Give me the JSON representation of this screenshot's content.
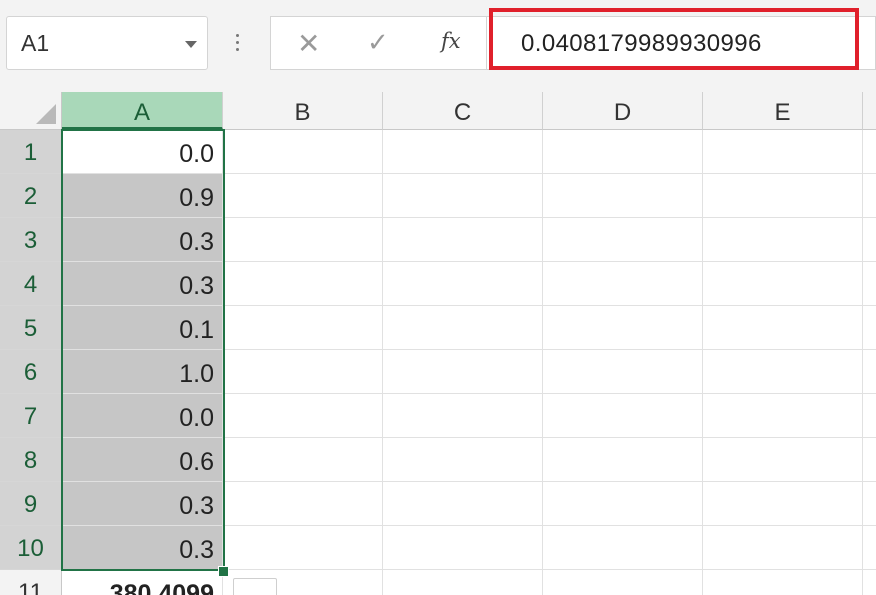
{
  "formula_bar": {
    "name_box": "A1",
    "cancel_icon": "✕",
    "enter_icon": "✓",
    "fx_label": "fx",
    "value": "0.0408179989930996"
  },
  "columns": [
    "A",
    "B",
    "C",
    "D",
    "E"
  ],
  "rows": [
    {
      "num": "1",
      "a": "0.0"
    },
    {
      "num": "2",
      "a": "0.9"
    },
    {
      "num": "3",
      "a": "0.3"
    },
    {
      "num": "4",
      "a": "0.3"
    },
    {
      "num": "5",
      "a": "0.1"
    },
    {
      "num": "6",
      "a": "1.0"
    },
    {
      "num": "7",
      "a": "0.0"
    },
    {
      "num": "8",
      "a": "0.6"
    },
    {
      "num": "9",
      "a": "0.3"
    },
    {
      "num": "10",
      "a": "0.3"
    },
    {
      "num": "11",
      "a": "380.4099"
    }
  ],
  "colors": {
    "selection_border": "#217346",
    "highlight_border": "#e0202b",
    "active_column_header": "#a9d8b9",
    "selected_cells": "#c6c6c6"
  }
}
